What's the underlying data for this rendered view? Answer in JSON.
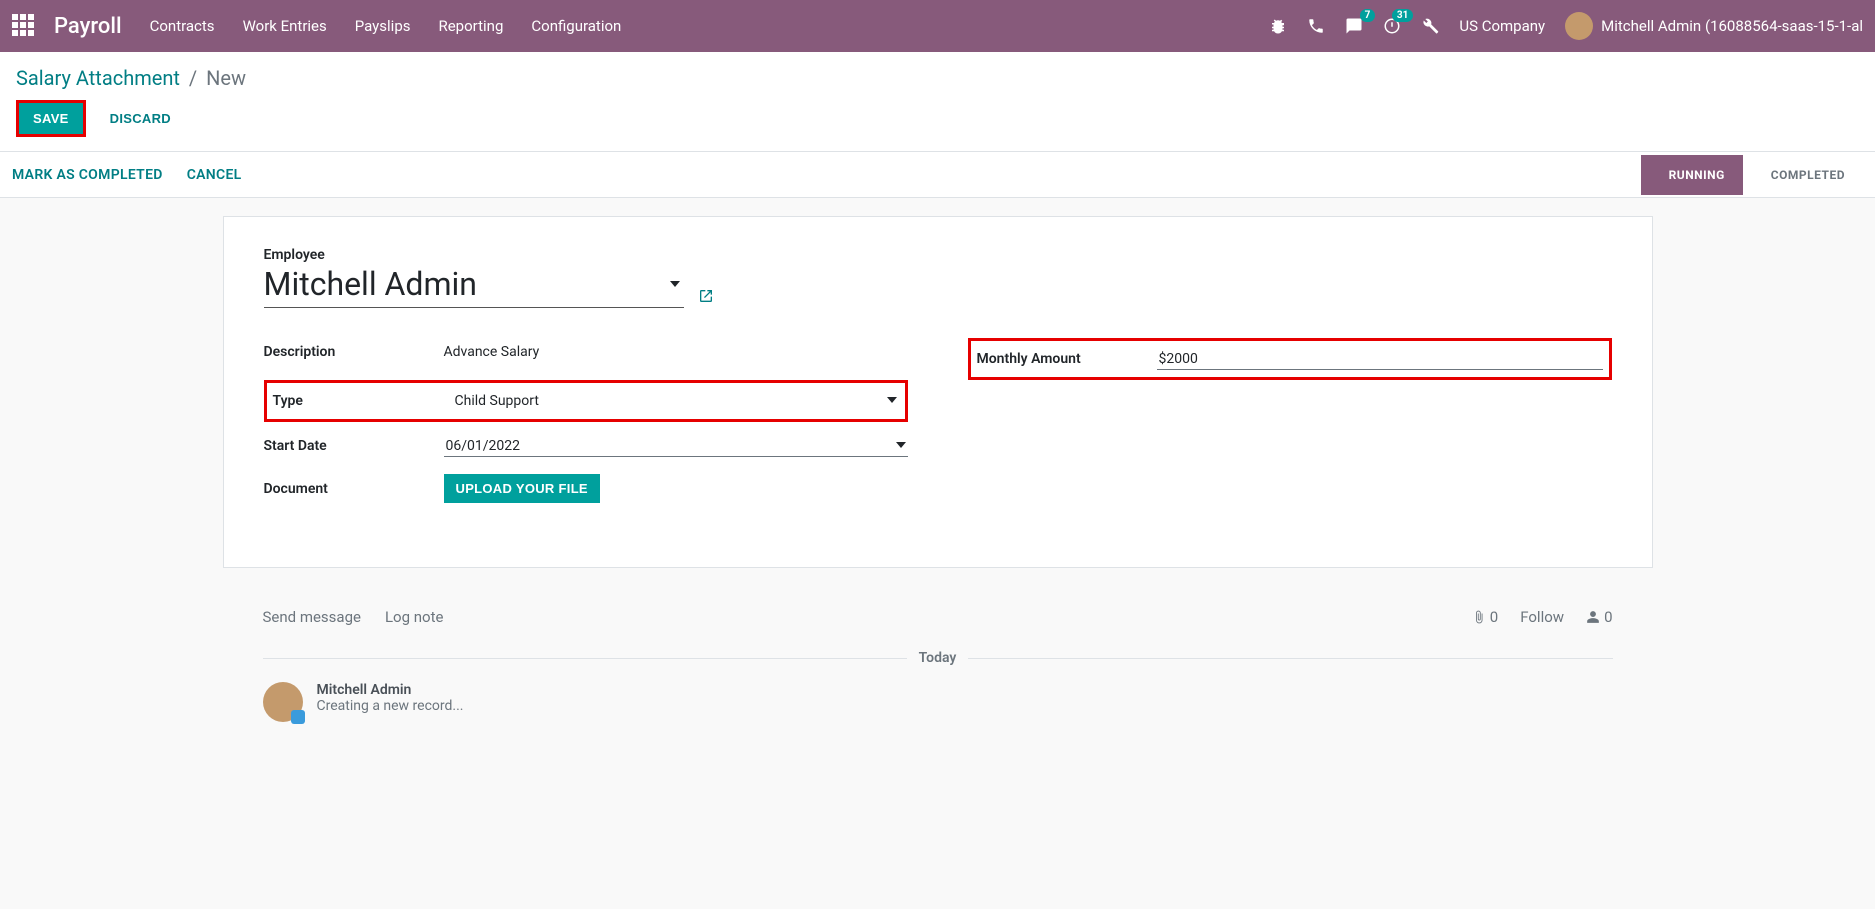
{
  "topbar": {
    "app_title": "Payroll",
    "menu": [
      "Contracts",
      "Work Entries",
      "Payslips",
      "Reporting",
      "Configuration"
    ],
    "badges": {
      "messages": "7",
      "activities": "31"
    },
    "company": "US Company",
    "user": "Mitchell Admin (16088564-saas-15-1-al"
  },
  "breadcrumb": {
    "root": "Salary Attachment",
    "current": "New"
  },
  "actions": {
    "save": "SAVE",
    "discard": "DISCARD"
  },
  "status": {
    "mark_completed": "MARK AS COMPLETED",
    "cancel": "CANCEL",
    "steps": {
      "running": "RUNNING",
      "completed": "COMPLETED"
    }
  },
  "form": {
    "labels": {
      "employee": "Employee",
      "description": "Description",
      "type": "Type",
      "start_date": "Start Date",
      "document": "Document",
      "monthly_amount": "Monthly Amount"
    },
    "values": {
      "employee": "Mitchell Admin",
      "description": "Advance Salary",
      "type": "Child Support",
      "start_date": "06/01/2022",
      "monthly_amount": "$2000"
    },
    "buttons": {
      "upload": "UPLOAD YOUR FILE"
    }
  },
  "chatter": {
    "send_message": "Send message",
    "log_note": "Log note",
    "attach_count": "0",
    "follow": "Follow",
    "follower_count": "0",
    "today": "Today",
    "msg_author": "Mitchell Admin",
    "msg_text": "Creating a new record..."
  }
}
